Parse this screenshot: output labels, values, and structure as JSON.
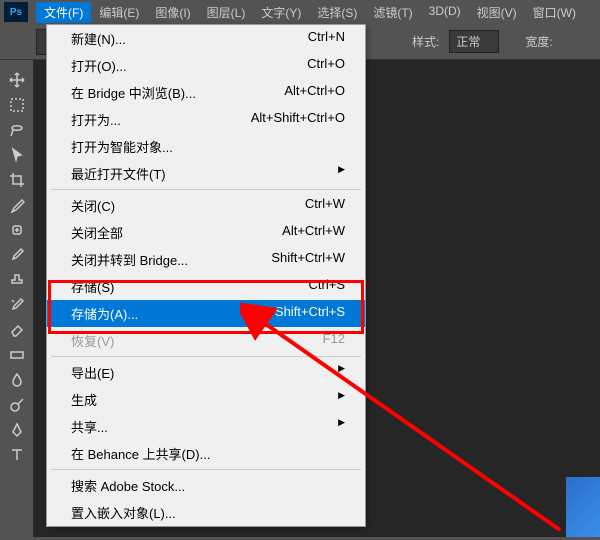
{
  "app_icon": "Ps",
  "menu": {
    "items": [
      "文件(F)",
      "编辑(E)",
      "图像(I)",
      "图层(L)",
      "文字(Y)",
      "选择(S)",
      "滤镜(T)",
      "3D(D)",
      "视图(V)",
      "窗口(W)"
    ]
  },
  "options": {
    "style_label": "样式:",
    "style_value": "正常",
    "width_label": "宽度:"
  },
  "dropdown": {
    "rows": [
      {
        "type": "item",
        "label": "新建(N)...",
        "shortcut": "Ctrl+N"
      },
      {
        "type": "item",
        "label": "打开(O)...",
        "shortcut": "Ctrl+O"
      },
      {
        "type": "item",
        "label": "在 Bridge 中浏览(B)...",
        "shortcut": "Alt+Ctrl+O"
      },
      {
        "type": "item",
        "label": "打开为...",
        "shortcut": "Alt+Shift+Ctrl+O"
      },
      {
        "type": "item",
        "label": "打开为智能对象..."
      },
      {
        "type": "item",
        "label": "最近打开文件(T)",
        "submenu": true
      },
      {
        "type": "sep"
      },
      {
        "type": "item",
        "label": "关闭(C)",
        "shortcut": "Ctrl+W"
      },
      {
        "type": "item",
        "label": "关闭全部",
        "shortcut": "Alt+Ctrl+W"
      },
      {
        "type": "item",
        "label": "关闭并转到 Bridge...",
        "shortcut": "Shift+Ctrl+W"
      },
      {
        "type": "item",
        "label": "存储(S)",
        "shortcut": "Ctrl+S"
      },
      {
        "type": "item",
        "label": "存储为(A)...",
        "shortcut": "Shift+Ctrl+S",
        "highlighted": true
      },
      {
        "type": "item",
        "label": "恢复(V)",
        "shortcut": "F12",
        "disabled": true
      },
      {
        "type": "sep"
      },
      {
        "type": "item",
        "label": "导出(E)",
        "submenu": true
      },
      {
        "type": "item",
        "label": "生成",
        "submenu": true
      },
      {
        "type": "item",
        "label": "共享...",
        "submenu": true
      },
      {
        "type": "item",
        "label": "在 Behance 上共享(D)..."
      },
      {
        "type": "sep"
      },
      {
        "type": "item",
        "label": "搜索 Adobe Stock..."
      },
      {
        "type": "item",
        "label": "置入嵌入对象(L)..."
      }
    ]
  }
}
